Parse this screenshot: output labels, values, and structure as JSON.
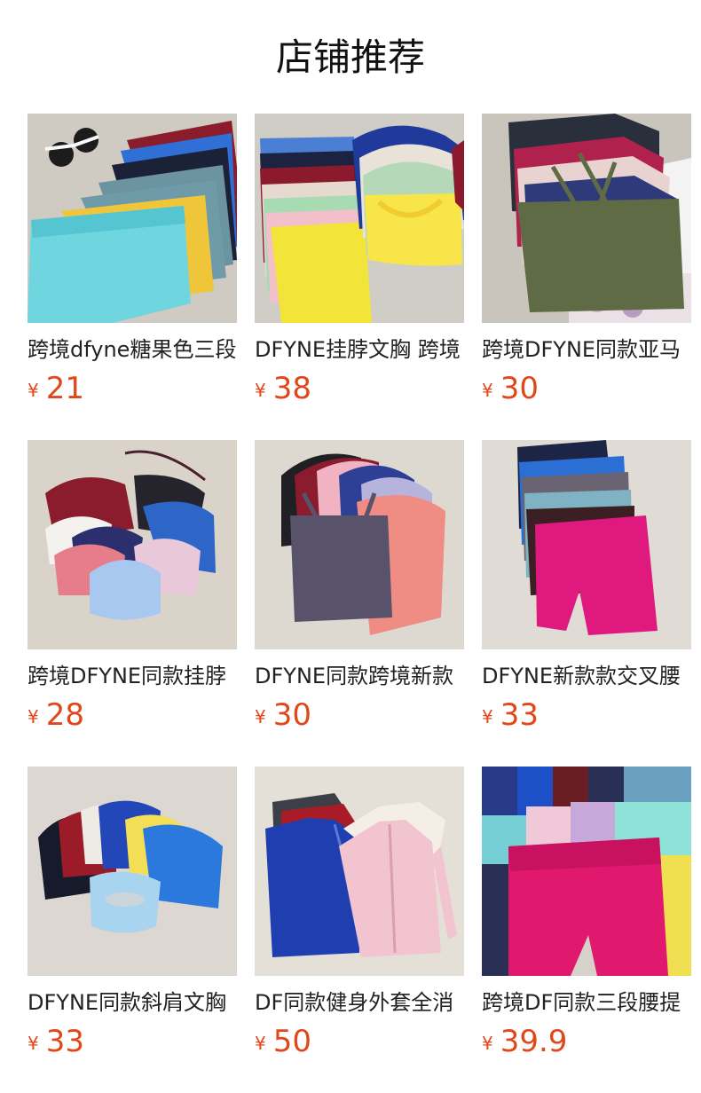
{
  "section_title": "店铺推荐",
  "currency": "¥",
  "accent_color": "#e0471b",
  "products": [
    {
      "name": "跨境dfyne糖果色三段",
      "price": "21"
    },
    {
      "name": "DFYNE挂脖文胸 跨境",
      "price": "38"
    },
    {
      "name": "跨境DFYNE同款亚马",
      "price": "30"
    },
    {
      "name": "跨境DFYNE同款挂脖",
      "price": "28"
    },
    {
      "name": "DFYNE同款跨境新款",
      "price": "30"
    },
    {
      "name": "DFYNE新款款交叉腰",
      "price": "33"
    },
    {
      "name": "DFYNE同款斜肩文胸",
      "price": "33"
    },
    {
      "name": "DF同款健身外套全消",
      "price": "50"
    },
    {
      "name": "跨境DF同款三段腰提",
      "price": "39.9"
    }
  ]
}
